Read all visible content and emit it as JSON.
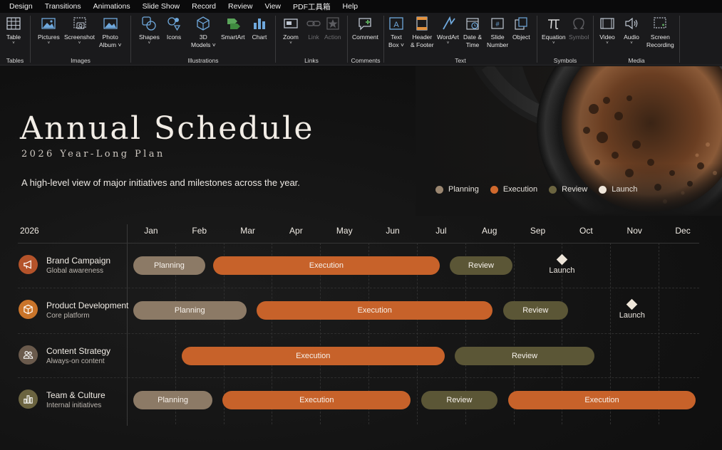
{
  "menu": [
    "Design",
    "Transitions",
    "Animations",
    "Slide Show",
    "Record",
    "Review",
    "View",
    "PDF工具箱",
    "Help"
  ],
  "ribbon": {
    "groups": {
      "tables": "Tables",
      "images": "Images",
      "illustrations": "Illustrations",
      "links": "Links",
      "comments": "Comments",
      "text": "Text",
      "symbols": "Symbols",
      "media": "Media"
    },
    "buttons": {
      "table": "Table",
      "pictures": "Pictures",
      "screenshot": "Screenshot",
      "photo_album": "Photo\nAlbum ˅",
      "shapes": "Shapes",
      "icons": "Icons",
      "models3d": "3D\nModels ˅",
      "smartart": "SmartArt",
      "chart": "Chart",
      "zoom": "Zoom",
      "link": "Link",
      "action": "Action",
      "comment": "Comment",
      "textbox": "Text\nBox ˅",
      "header_footer": "Header\n& Footer",
      "wordart": "WordArt",
      "date_time": "Date &\nTime",
      "slide_number": "Slide\nNumber",
      "object": "Object",
      "equation": "Equation",
      "symbol": "Symbol",
      "video": "Video",
      "audio": "Audio",
      "screen_recording": "Screen\nRecording"
    }
  },
  "slide": {
    "title": "Annual Schedule",
    "subtitle": "2026 Year-Long Plan",
    "description": "A high-level view of major initiatives and milestones across the year.",
    "legend": [
      {
        "label": "Planning",
        "color": "#9a8670"
      },
      {
        "label": "Execution",
        "color": "#d0692d"
      },
      {
        "label": "Review",
        "color": "#6b6440"
      },
      {
        "label": "Launch",
        "color": "#efe6da"
      }
    ],
    "year": "2026",
    "months": [
      "Jan",
      "Feb",
      "Mar",
      "Apr",
      "May",
      "Jun",
      "Jul",
      "Aug",
      "Sep",
      "Oct",
      "Nov",
      "Dec"
    ],
    "rows": [
      {
        "title": "Brand Campaign",
        "sub": "Global awareness",
        "icon": "megaphone-icon",
        "icon_color": "#b4532a",
        "bars": [
          {
            "phase": "Planning",
            "label": "Planning",
            "start": 1.0,
            "end": 2.65
          },
          {
            "phase": "Execution",
            "label": "Execution",
            "start": 2.65,
            "end": 7.5
          },
          {
            "phase": "Review",
            "label": "Review",
            "start": 7.55,
            "end": 9.0
          }
        ],
        "milestone": {
          "label": "Launch",
          "at": 10.0
        }
      },
      {
        "title": "Product Development",
        "sub": "Core platform",
        "icon": "cube-icon",
        "icon_color": "#c9742a",
        "bars": [
          {
            "phase": "Planning",
            "label": "Planning",
            "start": 1.0,
            "end": 3.5
          },
          {
            "phase": "Execution",
            "label": "Execution",
            "start": 3.55,
            "end": 8.6
          },
          {
            "phase": "Review",
            "label": "Review",
            "start": 8.65,
            "end": 10.15
          }
        ],
        "milestone": {
          "label": "Launch",
          "at": 11.45
        }
      },
      {
        "title": "Content Strategy",
        "sub": "Always-on content",
        "icon": "people-icon",
        "icon_color": "#6a5a4c",
        "bars": [
          {
            "phase": "Execution",
            "label": "Execution",
            "start": 2.0,
            "end": 7.6
          },
          {
            "phase": "Review",
            "label": "Review",
            "start": 7.65,
            "end": 10.7
          }
        ],
        "milestone": null
      },
      {
        "title": "Team & Culture",
        "sub": "Internal initiatives",
        "icon": "bar-chart-icon",
        "icon_color": "#6b6440",
        "bars": [
          {
            "phase": "Planning",
            "label": "Planning",
            "start": 1.0,
            "end": 2.8
          },
          {
            "phase": "Execution",
            "label": "Execution",
            "start": 2.85,
            "end": 6.9
          },
          {
            "phase": "Review",
            "label": "Review",
            "start": 6.95,
            "end": 8.7
          },
          {
            "phase": "Execution",
            "label": "Execution",
            "start": 8.75,
            "end": 12.8
          }
        ],
        "milestone": null
      }
    ]
  }
}
